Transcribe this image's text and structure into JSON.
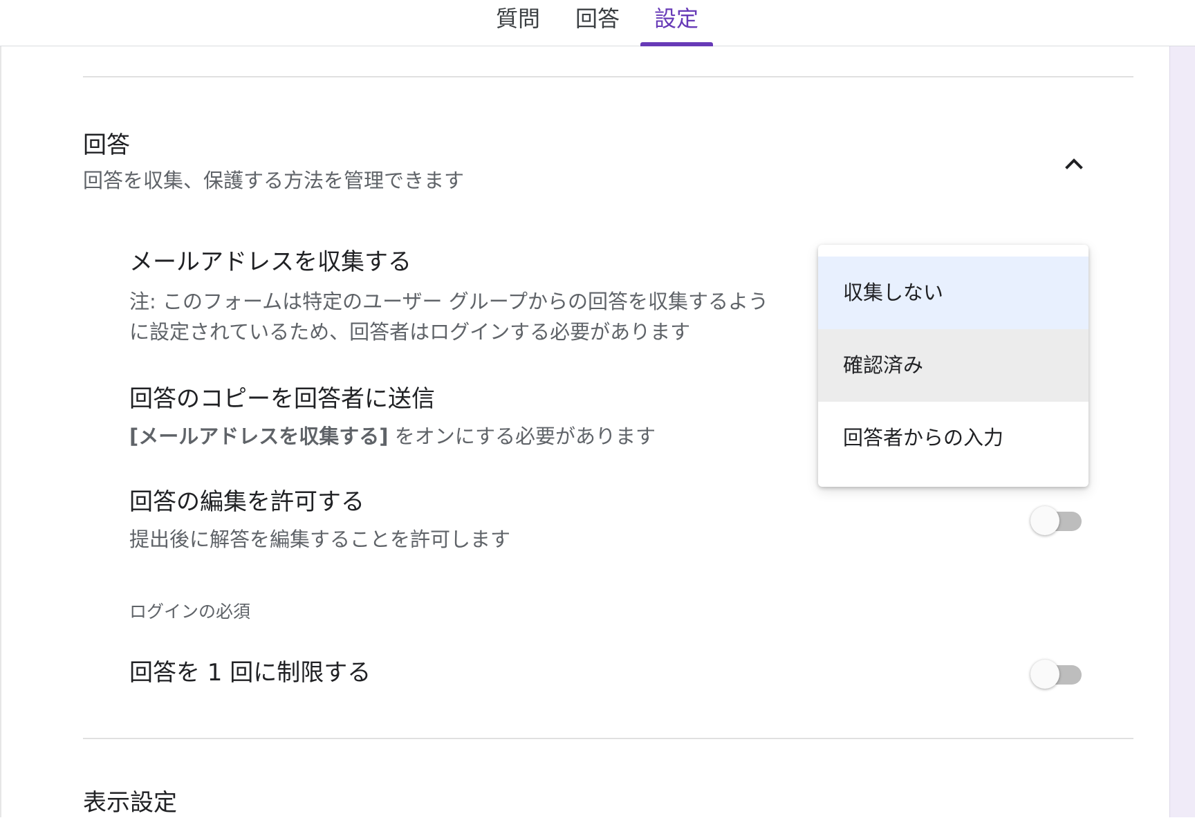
{
  "tabs": {
    "questions": "質問",
    "responses": "回答",
    "settings": "設定"
  },
  "responses_section": {
    "title": "回答",
    "description": "回答を収集、保護する方法を管理できます"
  },
  "collect_email": {
    "title": "メールアドレスを収集する",
    "note_line1": "注: このフォームは特定のユーザー グループからの回答を収集するよう",
    "note_line2": "に設定されているため、回答者はログインする必要があります"
  },
  "send_copy": {
    "title": "回答のコピーを回答者に送信",
    "desc_bold": "[メールアドレスを収集する]",
    "desc_rest": " をオンにする必要があります"
  },
  "allow_edit": {
    "title": "回答の編集を許可する",
    "description": "提出後に解答を編集することを許可します",
    "enabled": false
  },
  "login_required_label": "ログインの必須",
  "limit_one": {
    "title": "回答を 1 回に制限する",
    "enabled": false
  },
  "display_section": {
    "title": "表示設定"
  },
  "dropdown": {
    "options": [
      "収集しない",
      "確認済み",
      "回答者からの入力"
    ],
    "selected": "収集しない"
  },
  "colors": {
    "accent": "#673ab7",
    "selected_option_bg": "#e8f0fe",
    "hover_option_bg": "#ececec"
  }
}
